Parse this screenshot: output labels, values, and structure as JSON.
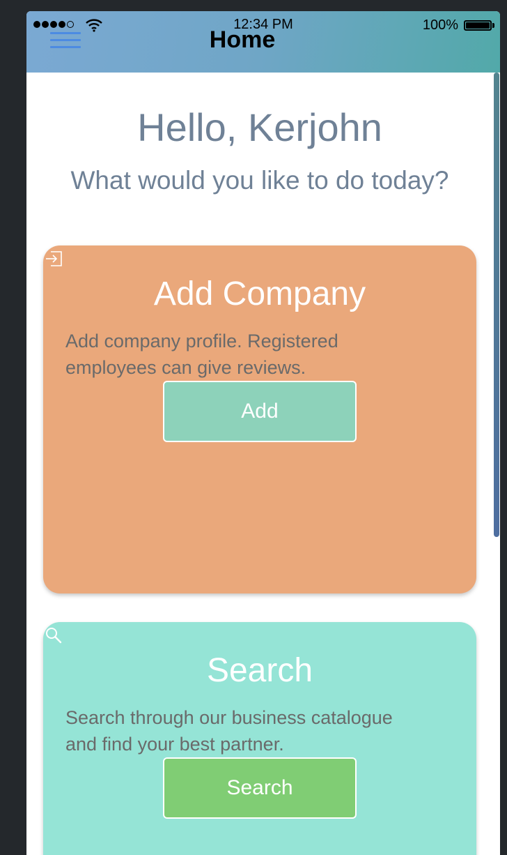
{
  "status_bar": {
    "time": "12:34 PM",
    "battery": "100%"
  },
  "header": {
    "title": "Home"
  },
  "greeting": {
    "title": "Hello, Kerjohn",
    "subtitle": "What would you like to do today?"
  },
  "cards": [
    {
      "title": "Add Company",
      "description": "Add company profile. Registered employees can give reviews.",
      "button": "Add",
      "icon": "sign-in-icon",
      "color": "#eaa87b",
      "button_color": "#8dd2ba"
    },
    {
      "title": "Search",
      "description": "Search through our business catalogue and find your best partner.",
      "button": "Search",
      "icon": "search-icon",
      "color": "#95e4d6",
      "button_color": "#80cd74"
    }
  ],
  "colors": {
    "header_gradient_start": "#7ba9d3",
    "header_gradient_end": "#52a9a9",
    "menu_icon": "#4c8be2",
    "text_muted": "#6f8196"
  }
}
